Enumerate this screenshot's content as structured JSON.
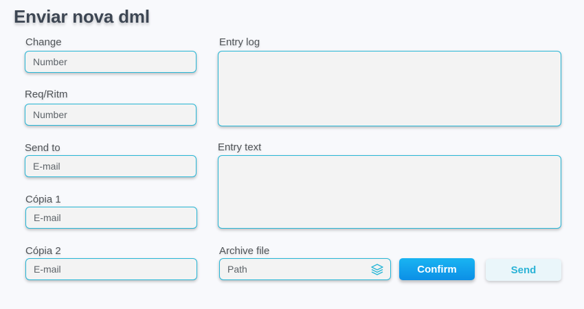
{
  "title": "Enviar nova dml",
  "fields": {
    "change": {
      "label": "Change",
      "placeholder": "Number"
    },
    "req_ritm": {
      "label": "Req/Ritm",
      "placeholder": "Number"
    },
    "send_to": {
      "label": "Send to",
      "placeholder": "E-mail"
    },
    "copia1": {
      "label": "Cópia 1",
      "placeholder": "E-mail"
    },
    "copia2": {
      "label": "Cópia 2",
      "placeholder": "E-mail"
    },
    "entry_log": {
      "label": "Entry log",
      "value": ""
    },
    "entry_text": {
      "label": "Entry text",
      "value": ""
    },
    "archive_file": {
      "label": "Archive file",
      "placeholder": "Path",
      "icon": "layers-icon"
    }
  },
  "buttons": {
    "confirm": "Confirm",
    "send": "Send"
  },
  "colors": {
    "accent": "#27b6d6",
    "confirm_button": "#0c8fe6",
    "field_background": "#f3f3f3",
    "page_background": "#f8f9fc"
  }
}
